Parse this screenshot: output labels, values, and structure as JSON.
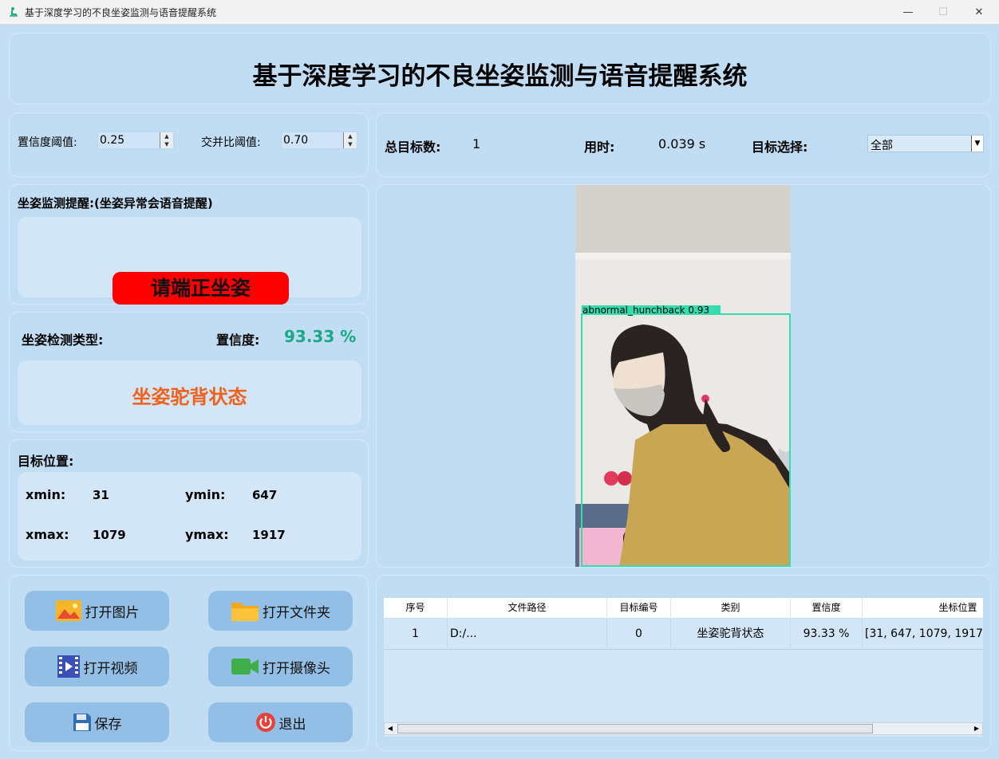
{
  "window": {
    "title": "基于深度学习的不良坐姿监测与语音提醒系统",
    "minimize": "—",
    "maximize": "☐",
    "close": "✕"
  },
  "header": {
    "title": "基于深度学习的不良坐姿监测与语音提醒系统"
  },
  "params": {
    "conf_label": "置信度阈值:",
    "conf_value": "0.25",
    "iou_label": "交并比阈值:",
    "iou_value": "0.70"
  },
  "stats": {
    "total_label": "总目标数:",
    "total_value": "1",
    "time_label": "用时:",
    "time_value": "0.039 s",
    "select_label": "目标选择:",
    "select_value": "全部"
  },
  "reminder": {
    "label": "坐姿监测提醒:(坐姿异常会语音提醒)",
    "alert_text": "请端正坐姿",
    "alert_color": "#ff0000"
  },
  "detection": {
    "type_label": "坐姿检测类型:",
    "conf_label": "置信度:",
    "conf_value": "93.33 %",
    "conf_color": "#1aa886",
    "type_value": "坐姿驼背状态",
    "type_color": "#f0621c"
  },
  "position": {
    "label": "目标位置:",
    "xmin_label": "xmin:",
    "xmin": "31",
    "ymin_label": "ymin:",
    "ymin": "647",
    "xmax_label": "xmax:",
    "xmax": "1079",
    "ymax_label": "ymax:",
    "ymax": "1917"
  },
  "buttons": {
    "open_image": "打开图片",
    "open_folder": "打开文件夹",
    "open_video": "打开视频",
    "open_camera": "打开摄像头",
    "save": "保存",
    "exit": "退出"
  },
  "detection_box": {
    "label": "abnormal_hunchback  0.93",
    "color": "#33ddb0"
  },
  "table": {
    "columns": [
      "序号",
      "文件路径",
      "目标编号",
      "类别",
      "置信度",
      "坐标位置"
    ],
    "rows": [
      [
        "1",
        "D:/...",
        "0",
        "坐姿驼背状态",
        "93.33 %",
        "[31, 647, 1079, 1917]"
      ]
    ]
  }
}
